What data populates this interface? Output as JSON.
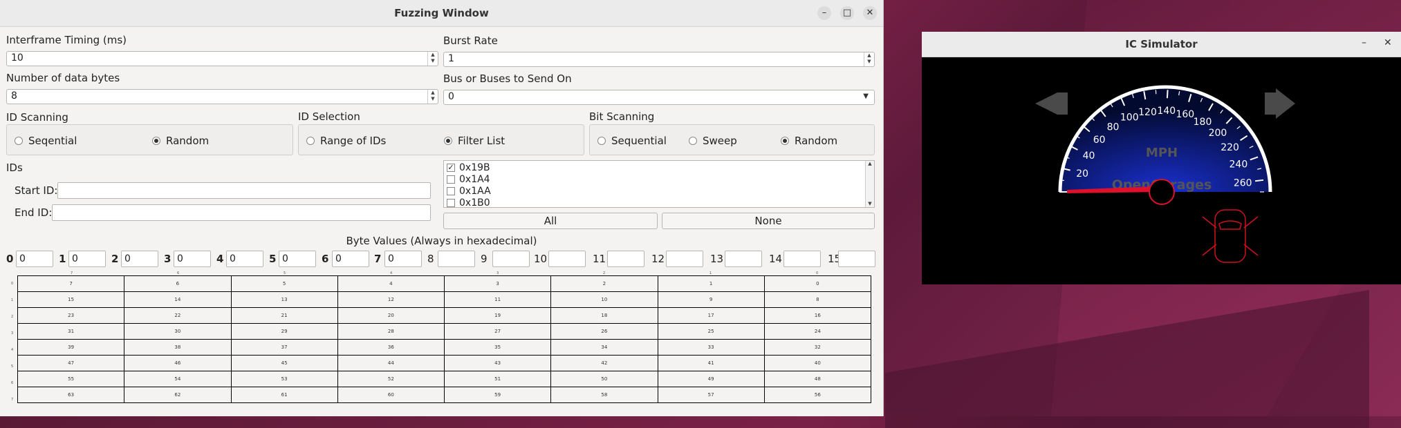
{
  "fuzz": {
    "title": "Fuzzing Window",
    "interframe_label": "Interframe Timing (ms)",
    "interframe_value": "10",
    "burst_label": "Burst Rate",
    "burst_value": "1",
    "databytes_label": "Number of data bytes",
    "databytes_value": "8",
    "bus_label": "Bus or Buses to Send On",
    "bus_value": "0",
    "id_scanning": {
      "label": "ID Scanning",
      "options": [
        "Seqential",
        "Random"
      ],
      "selected": "Random"
    },
    "id_selection": {
      "label": "ID Selection",
      "options": [
        "Range of IDs",
        "Filter List"
      ],
      "selected": "Filter List"
    },
    "bit_scanning": {
      "label": "Bit Scanning",
      "options": [
        "Sequential",
        "Sweep",
        "Random"
      ],
      "selected": "Random"
    },
    "ids_label": "IDs",
    "start_id_label": "Start ID:",
    "end_id_label": "End ID:",
    "filter_list": [
      {
        "label": "0x19B",
        "checked": true
      },
      {
        "label": "0x1A4",
        "checked": false
      },
      {
        "label": "0x1AA",
        "checked": false
      },
      {
        "label": "0x1B0",
        "checked": false
      }
    ],
    "all_button": "All",
    "none_button": "None",
    "byte_values_label": "Byte Values (Always in hexadecimal)",
    "byte_labels": [
      "0",
      "1",
      "2",
      "3",
      "4",
      "5",
      "6",
      "7",
      "8",
      "9",
      "10",
      "11",
      "12",
      "13",
      "14",
      "15"
    ],
    "byte_values": [
      "0",
      "0",
      "0",
      "0",
      "0",
      "0",
      "0",
      "0",
      "",
      "",
      "",
      "",
      "",
      "",
      "",
      ""
    ],
    "grid_rows": [
      [
        "7",
        "6",
        "5",
        "4",
        "3",
        "2",
        "1",
        "0"
      ],
      [
        "15",
        "14",
        "13",
        "12",
        "11",
        "10",
        "9",
        "8"
      ],
      [
        "23",
        "22",
        "21",
        "20",
        "19",
        "18",
        "17",
        "16"
      ],
      [
        "31",
        "30",
        "29",
        "28",
        "27",
        "26",
        "25",
        "24"
      ],
      [
        "39",
        "38",
        "37",
        "36",
        "35",
        "34",
        "33",
        "32"
      ],
      [
        "47",
        "46",
        "45",
        "44",
        "43",
        "42",
        "41",
        "40"
      ],
      [
        "55",
        "54",
        "53",
        "52",
        "51",
        "50",
        "49",
        "48"
      ],
      [
        "63",
        "62",
        "61",
        "60",
        "59",
        "58",
        "57",
        "56"
      ]
    ],
    "grid_row_headers": [
      "0",
      "1",
      "2",
      "3",
      "4",
      "5",
      "6",
      "7"
    ],
    "grid_col_headers": [
      "7",
      "6",
      "5",
      "4",
      "3",
      "2",
      "1",
      "0"
    ]
  },
  "ic": {
    "title": "IC Simulator",
    "unit": "MPH",
    "brand": "OpenGarages",
    "speed_ticks": [
      "20",
      "40",
      "60",
      "80",
      "100",
      "120",
      "140",
      "160",
      "180",
      "200",
      "220",
      "240",
      "260"
    ],
    "needle_speed": 0,
    "colors": {
      "needle": "#e0102a",
      "dial": "#1a30d0",
      "arrow": "#4a4a4a"
    }
  }
}
